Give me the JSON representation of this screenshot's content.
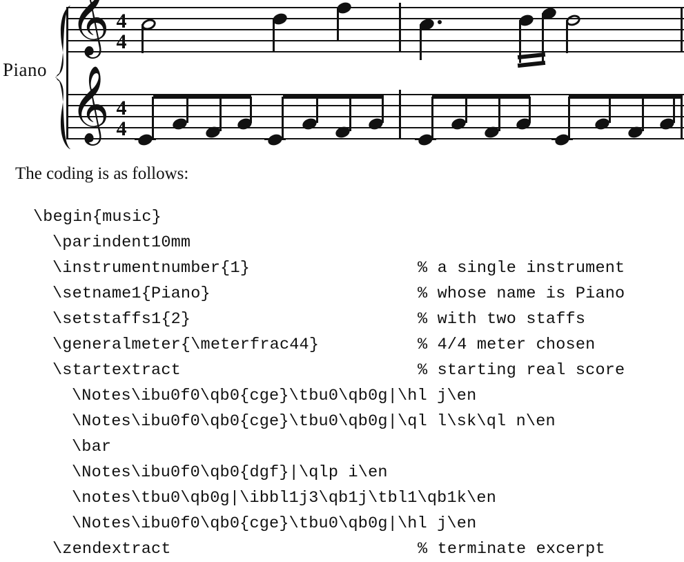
{
  "score": {
    "instrument_label": "Piano",
    "meter": {
      "numerator": "4",
      "denominator": "4"
    },
    "clef": "treble-clef",
    "clef_glyph": "𝄞",
    "staves": 2,
    "measures": 2
  },
  "prose": {
    "intro_line": "The coding is as follows:"
  },
  "code": {
    "lines": [
      {
        "indent": 0,
        "text": "\\begin{music}",
        "comment": ""
      },
      {
        "indent": 1,
        "text": "\\parindent10mm",
        "comment": ""
      },
      {
        "indent": 1,
        "text": "\\instrumentnumber{1}",
        "comment": "% a single instrument"
      },
      {
        "indent": 1,
        "text": "\\setname1{Piano}",
        "comment": "% whose name is Piano"
      },
      {
        "indent": 1,
        "text": "\\setstaffs1{2}",
        "comment": "% with two staffs"
      },
      {
        "indent": 1,
        "text": "\\generalmeter{\\meterfrac44}",
        "comment": "% 4/4 meter chosen"
      },
      {
        "indent": 1,
        "text": "\\startextract",
        "comment": "% starting real score"
      },
      {
        "indent": 2,
        "text": "\\Notes\\ibu0f0\\qb0{cge}\\tbu0\\qb0g|\\hl j\\en",
        "comment": ""
      },
      {
        "indent": 2,
        "text": "\\Notes\\ibu0f0\\qb0{cge}\\tbu0\\qb0g|\\ql l\\sk\\ql n\\en",
        "comment": ""
      },
      {
        "indent": 2,
        "text": "\\bar",
        "comment": ""
      },
      {
        "indent": 2,
        "text": "\\Notes\\ibu0f0\\qb0{dgf}|\\qlp i\\en",
        "comment": ""
      },
      {
        "indent": 2,
        "text": "\\notes\\tbu0\\qb0g|\\ibbl1j3\\qb1j\\tbl1\\qb1k\\en",
        "comment": ""
      },
      {
        "indent": 2,
        "text": "\\Notes\\ibu0f0\\qb0{cge}\\tbu0\\qb0g|\\hl j\\en",
        "comment": ""
      },
      {
        "indent": 1,
        "text": "\\zendextract",
        "comment": "% terminate excerpt"
      }
    ]
  },
  "colors": {
    "ink": "#111111",
    "page": "#ffffff"
  }
}
